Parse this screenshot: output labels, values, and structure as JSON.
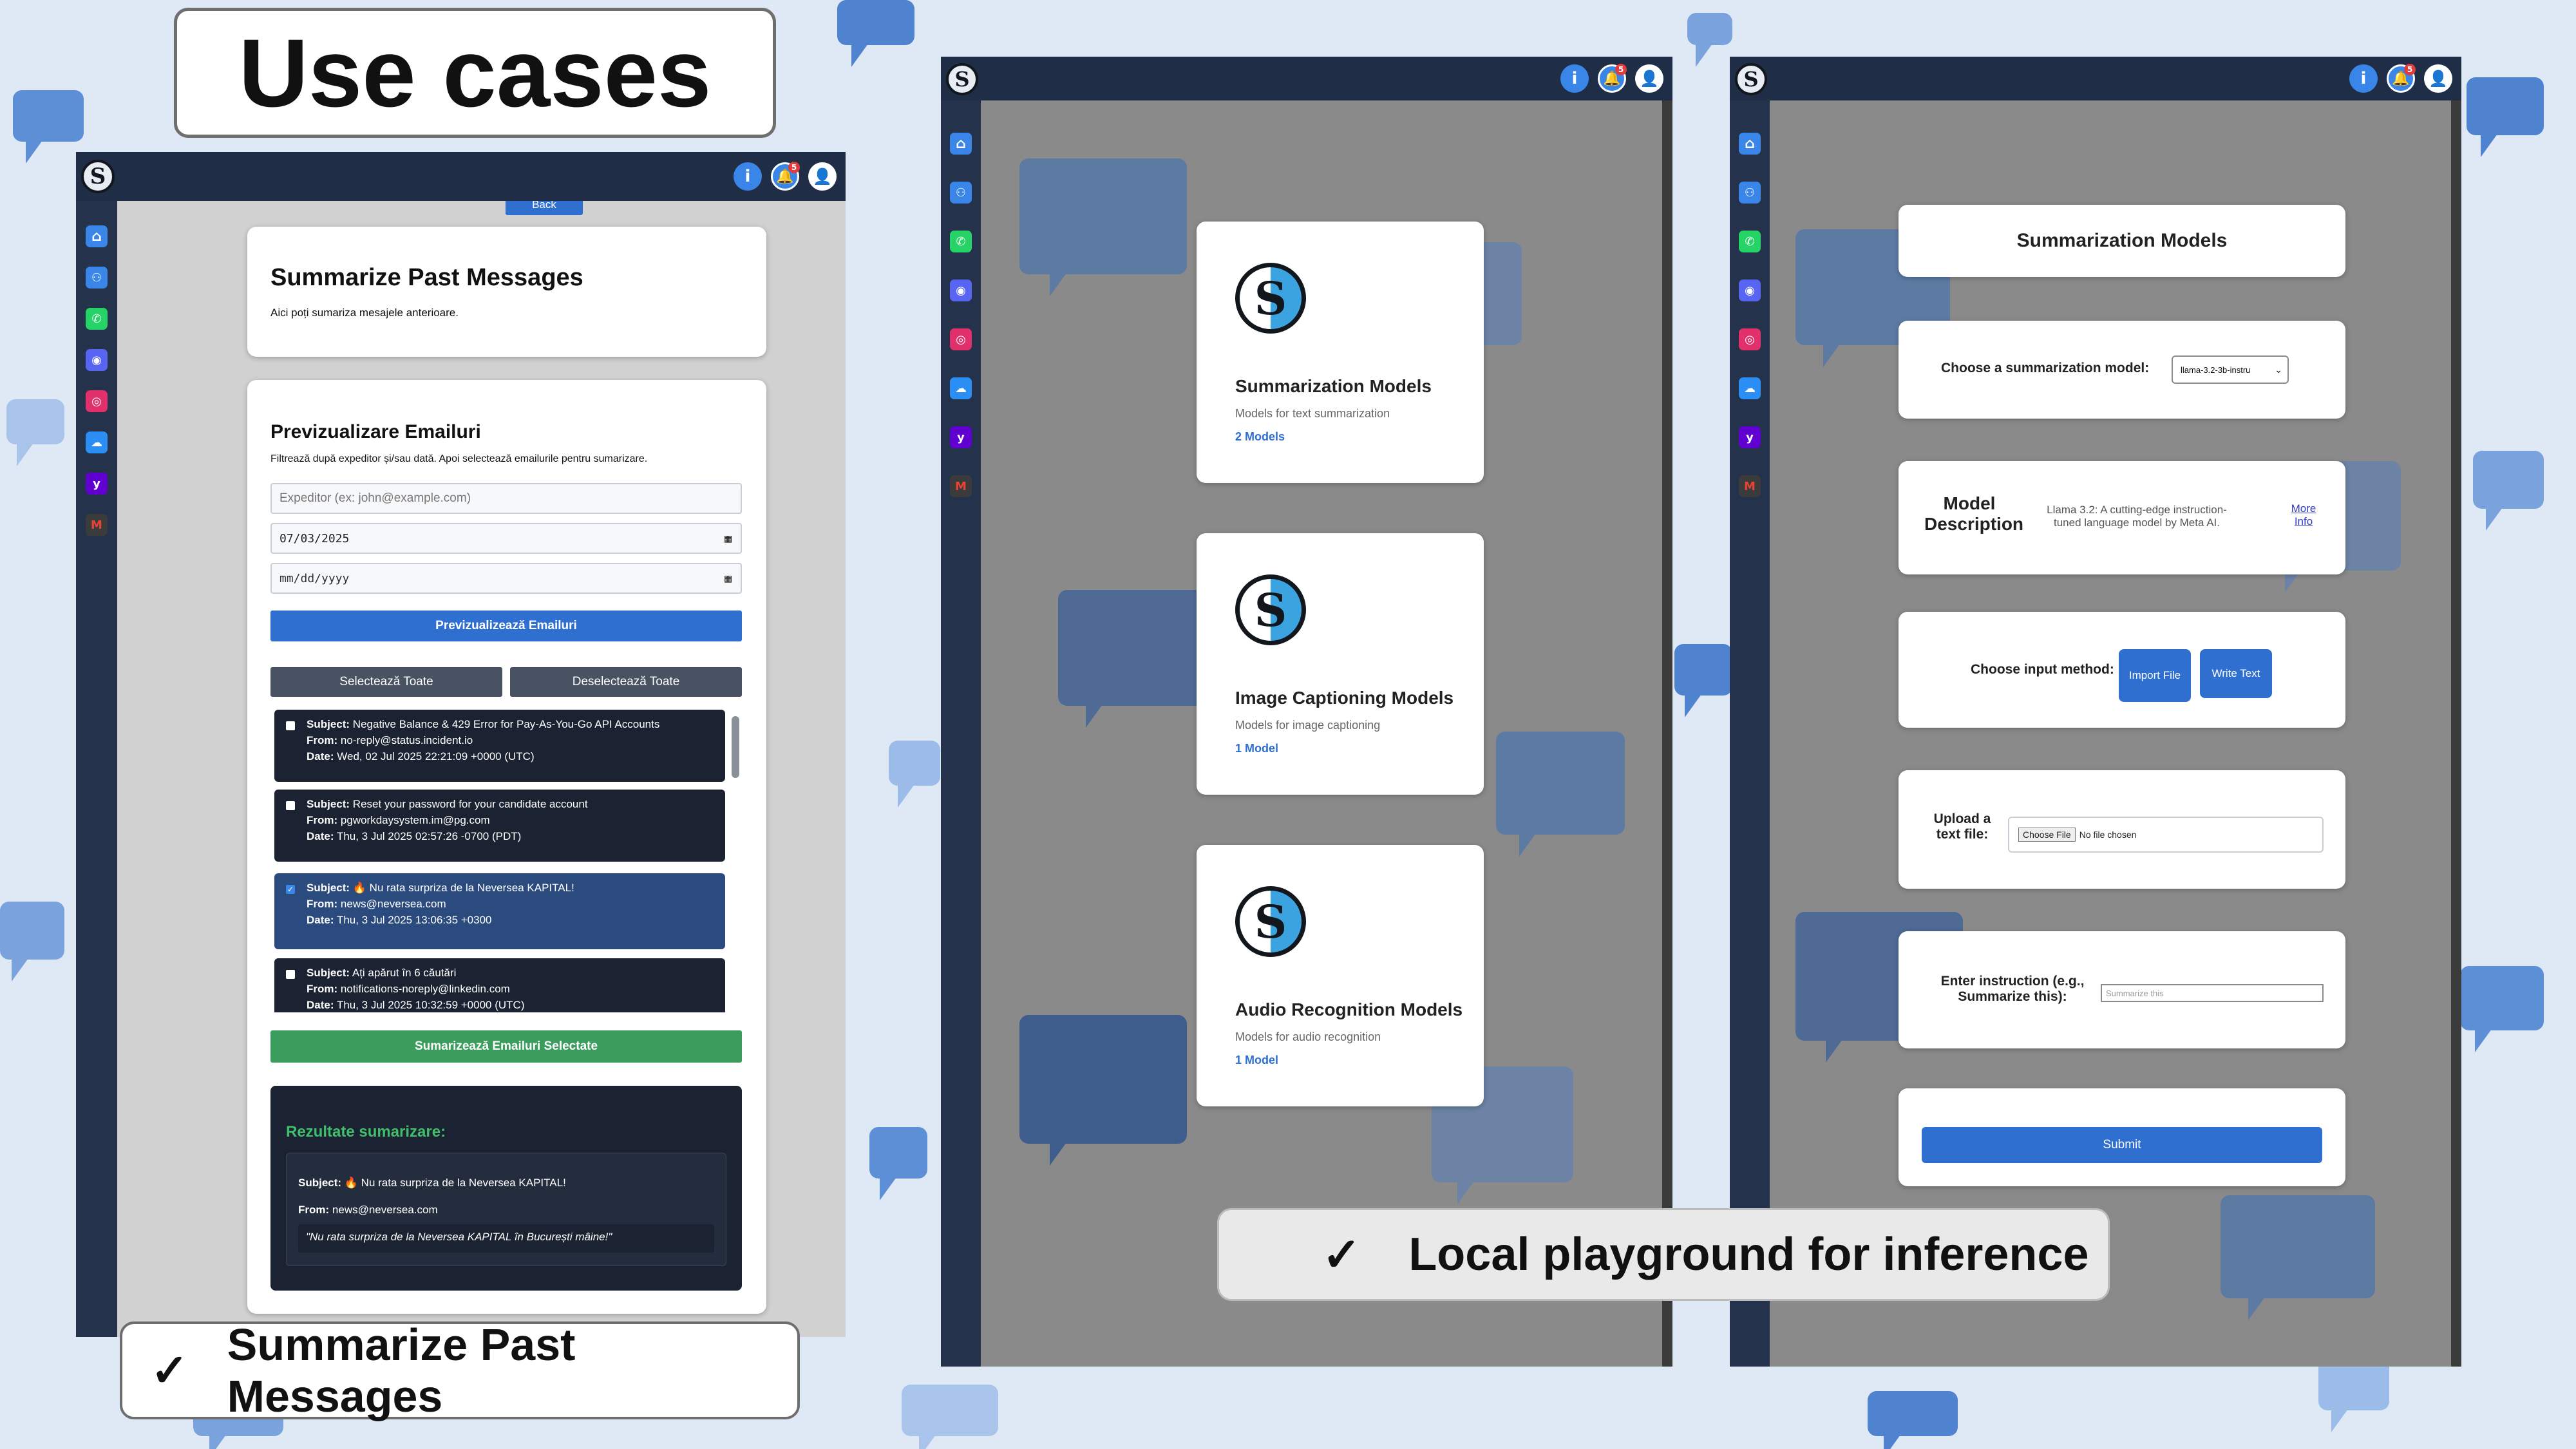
{
  "slide": {
    "title": "Use cases",
    "check_mark": "✓",
    "caption_left": "Summarize Past Messages",
    "caption_center": "Local playground for inference"
  },
  "colors": {
    "navy": "#1f2d46",
    "sidebar": "#24324c",
    "primary": "#2f6fd0",
    "green": "#3a9d5d",
    "slate": "#485263"
  },
  "app": {
    "logo_text": "S",
    "info_icon": "i",
    "notification_count": "5",
    "sidebar_icons": [
      "home-icon",
      "users-icon",
      "whatsapp-icon",
      "discord-icon",
      "instagram-icon",
      "icloud-icon",
      "yahoo-icon",
      "gmail-icon"
    ]
  },
  "summarize": {
    "back_label": "Back",
    "header": {
      "title": "Summarize Past Messages",
      "subtitle": "Aici poți sumariza mesajele anterioare."
    },
    "preview": {
      "title": "Previzualizare Emailuri",
      "description": "Filtrează după expeditor și/sau dată. Apoi selectează emailurile pentru sumarizare.",
      "sender_placeholder": "Expeditor (ex: john@example.com)",
      "date_from": "07/03/2025",
      "date_to_placeholder": "mm/dd/yyyy",
      "preview_button": "Previzualizează Emailuri",
      "select_all": "Selectează Toate",
      "deselect_all": "Deselectează Toate",
      "subject_label": "Subject:",
      "from_label": "From:",
      "date_label": "Date:",
      "emails": [
        {
          "subject": "Negative Balance & 429 Error for Pay-As-You-Go API Accounts",
          "from": "no-reply@status.incident.io",
          "date": "Wed, 02 Jul 2025 22:21:09 +0000 (UTC)",
          "selected": false
        },
        {
          "subject": "Reset your password for your candidate account",
          "from": "pgworkdaysystem.im@pg.com",
          "date": "Thu, 3 Jul 2025 02:57:26 -0700 (PDT)",
          "selected": false
        },
        {
          "subject": "🔥 Nu rata surpriza de la Neversea KAPITAL!",
          "from": "news@neversea.com",
          "date": "Thu, 3 Jul 2025 13:06:35 +0300",
          "selected": true
        },
        {
          "subject": "Ați apărut în 6 căutări",
          "from": "notifications-noreply@linkedin.com",
          "date": "Thu, 3 Jul 2025 10:32:59 +0000 (UTC)",
          "selected": false
        }
      ],
      "summarize_button": "Sumarizează Emailuri Selectate"
    },
    "results": {
      "title": "Rezultate sumarizare:",
      "subject_label": "Subject:",
      "subject": "🔥 Nu rata surpriza de la Neversea KAPITAL!",
      "from_label": "From:",
      "from": "news@neversea.com",
      "summary": "\"Nu rata surpriza de la Neversea KAPITAL în București mâine!\""
    }
  },
  "models": [
    {
      "title": "Summarization Models",
      "desc": "Models for text summarization",
      "count": "2 Models"
    },
    {
      "title": "Image Captioning Models",
      "desc": "Models for image captioning",
      "count": "1 Model"
    },
    {
      "title": "Audio Recognition Models",
      "desc": "Models for audio recognition",
      "count": "1 Model"
    }
  ],
  "summ_page": {
    "title": "Summarization Models",
    "choose_label": "Choose a summarization model:",
    "choose_value": "llama-3.2-3b-instru",
    "desc_label": "Model Description",
    "desc_text": "Llama 3.2: A cutting-edge instruction-tuned language model by Meta AI.",
    "more_info": "More Info",
    "input_method_label": "Choose input method:",
    "import_file": "Import File",
    "write_text": "Write Text",
    "upload_label": "Upload a text file:",
    "choose_file": "Choose File",
    "no_file": "No file chosen",
    "instruction_label": "Enter instruction (e.g., Summarize this):",
    "instruction_placeholder": "Summarize this",
    "submit": "Submit"
  }
}
